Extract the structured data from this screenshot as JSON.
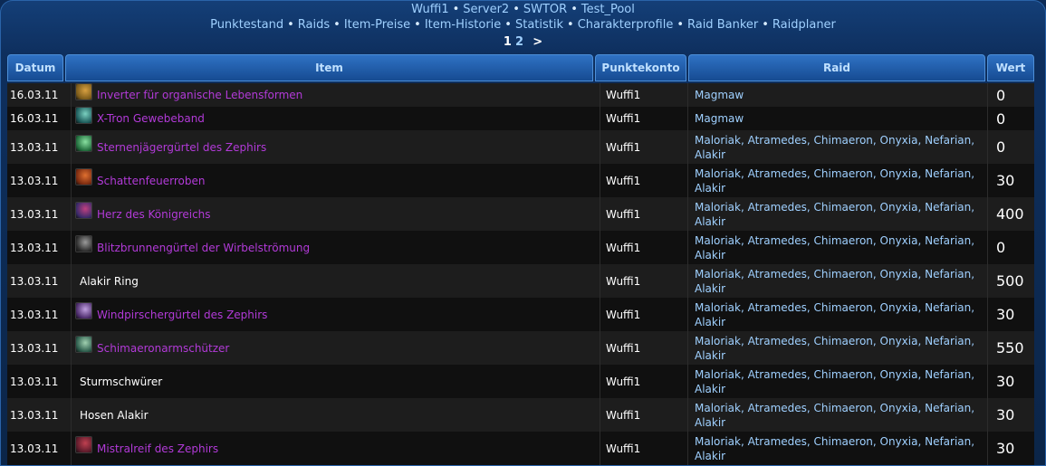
{
  "header": {
    "crumbs": [
      "Wuffi1",
      "Server2",
      "SWTOR",
      "Test_Pool"
    ]
  },
  "nav": {
    "items": [
      "Punktestand",
      "Raids",
      "Item-Preise",
      "Item-Historie",
      "Statistik",
      "Charakterprofile",
      "Raid Banker",
      "Raidplaner"
    ]
  },
  "pager": {
    "current": "1",
    "page2": "2",
    "next": ">"
  },
  "table": {
    "columns": {
      "date": "Datum",
      "item": "Item",
      "account": "Punktekonto",
      "raid": "Raid",
      "value": "Wert"
    },
    "rows": [
      {
        "date": "16.03.11",
        "item": "Inverter für organische Lebensformen",
        "link": true,
        "icon": "gear-trinket-icon",
        "account": "Wuffi1",
        "raid": "Magmaw",
        "value": "0"
      },
      {
        "date": "16.03.11",
        "item": "X-Tron Gewebeband",
        "link": true,
        "icon": "bracer-icon",
        "account": "Wuffi1",
        "raid": "Magmaw",
        "value": "0"
      },
      {
        "date": "13.03.11",
        "item": "Sternenjägergürtel des Zephirs",
        "link": true,
        "icon": "belt-icon",
        "account": "Wuffi1",
        "raid": "Maloriak, Atramedes, Chimaeron, Onyxia, Nefarian, Alakir",
        "value": "0"
      },
      {
        "date": "13.03.11",
        "item": "Schattenfeuerroben",
        "link": true,
        "icon": "robe-icon",
        "account": "Wuffi1",
        "raid": "Maloriak, Atramedes, Chimaeron, Onyxia, Nefarian, Alakir",
        "value": "30"
      },
      {
        "date": "13.03.11",
        "item": "Herz des Königreichs",
        "link": true,
        "icon": "heart-trinket-icon",
        "account": "Wuffi1",
        "raid": "Maloriak, Atramedes, Chimaeron, Onyxia, Nefarian, Alakir",
        "value": "400"
      },
      {
        "date": "13.03.11",
        "item": "Blitzbrunnengürtel der Wirbelströmung",
        "link": true,
        "icon": "belt-dark-icon",
        "account": "Wuffi1",
        "raid": "Maloriak, Atramedes, Chimaeron, Onyxia, Nefarian, Alakir",
        "value": "0"
      },
      {
        "date": "13.03.11",
        "item": "Alakir Ring",
        "link": false,
        "icon": "",
        "account": "Wuffi1",
        "raid": "Maloriak, Atramedes, Chimaeron, Onyxia, Nefarian, Alakir",
        "value": "500"
      },
      {
        "date": "13.03.11",
        "item": "Windpirschergürtel des Zephirs",
        "link": true,
        "icon": "belt-purple-icon",
        "account": "Wuffi1",
        "raid": "Maloriak, Atramedes, Chimaeron, Onyxia, Nefarian, Alakir",
        "value": "30"
      },
      {
        "date": "13.03.11",
        "item": "Schimaeronarmschützer",
        "link": true,
        "icon": "bracer-green-icon",
        "account": "Wuffi1",
        "raid": "Maloriak, Atramedes, Chimaeron, Onyxia, Nefarian, Alakir",
        "value": "550"
      },
      {
        "date": "13.03.11",
        "item": "Sturmschwürer",
        "link": false,
        "icon": "",
        "account": "Wuffi1",
        "raid": "Maloriak, Atramedes, Chimaeron, Onyxia, Nefarian, Alakir",
        "value": "30"
      },
      {
        "date": "13.03.11",
        "item": "Hosen Alakir",
        "link": false,
        "icon": "",
        "account": "Wuffi1",
        "raid": "Maloriak, Atramedes, Chimaeron, Onyxia, Nefarian, Alakir",
        "value": "30"
      },
      {
        "date": "13.03.11",
        "item": "Mistralreif des Zephirs",
        "link": true,
        "icon": "helm-icon",
        "account": "Wuffi1",
        "raid": "Maloriak, Atramedes, Chimaeron, Onyxia, Nefarian, Alakir",
        "value": "30"
      }
    ]
  },
  "colors": {
    "item_link": "#b23ad8",
    "raid_text": "#9fd0ff",
    "header_bg": "#1f5ca8"
  }
}
